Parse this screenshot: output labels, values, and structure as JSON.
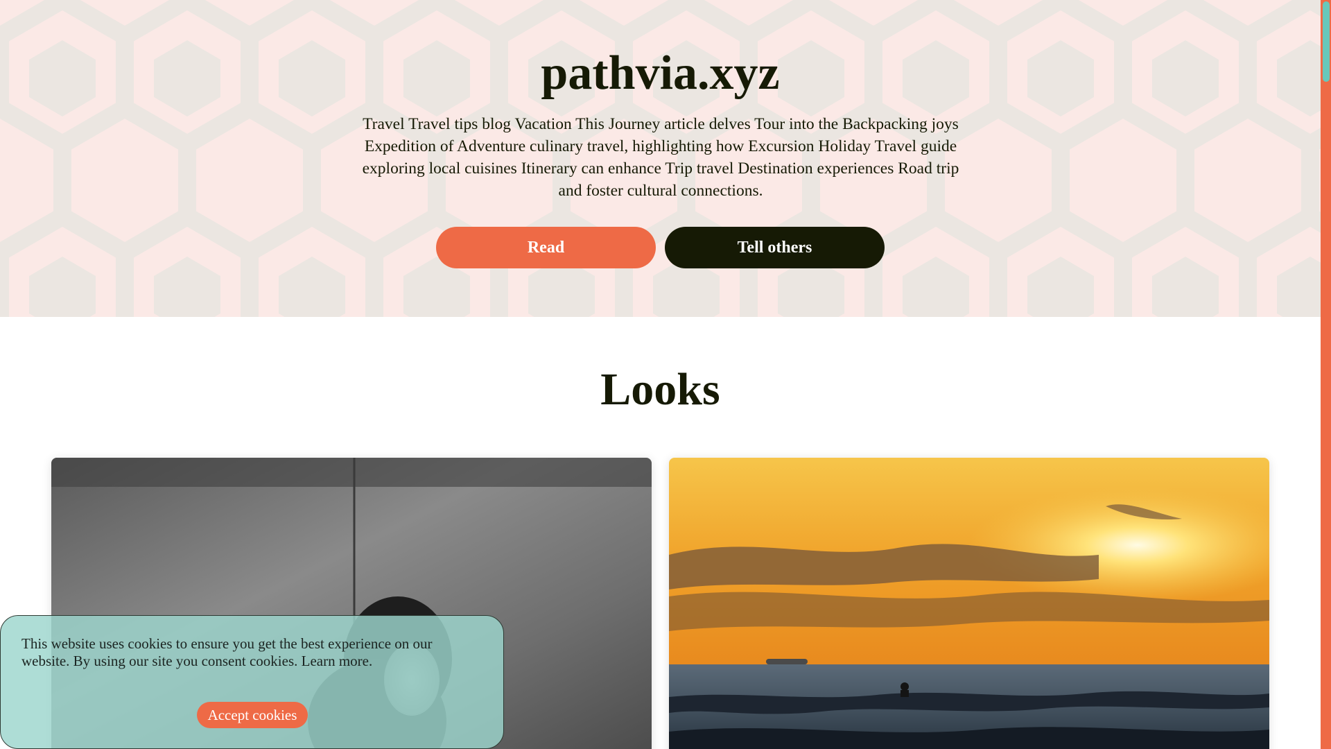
{
  "hero": {
    "site_title": "pathvia.xyz",
    "description": "Travel Travel tips blog Vacation This Journey article delves Tour into the Backpacking joys Expedition of Adventure culinary travel, highlighting how Excursion Holiday Travel guide exploring local cuisines Itinerary can enhance Trip travel Destination experiences Road trip and foster cultural connections.",
    "buttons": {
      "read_label": "Read",
      "tell_label": "Tell others"
    }
  },
  "looks": {
    "title": "Looks",
    "cards": [
      {
        "image": "black-and-white-photo-of-woman-with-curly-hair"
      },
      {
        "image": "sunset-over-sea-with-surfer"
      }
    ]
  },
  "cookie_banner": {
    "text": "This website uses cookies to ensure you get the best experience on our website. By using our site you consent cookies. Learn more.",
    "accept_label": "Accept cookies"
  },
  "colors": {
    "accent": "#ee6a46",
    "dark": "#161a05",
    "hero_bg": "#fbe9e6",
    "hero_pattern": "#ebe6e1",
    "cookie_bg": "#9cd6cd",
    "scroll_thumb": "#67c8bb"
  }
}
